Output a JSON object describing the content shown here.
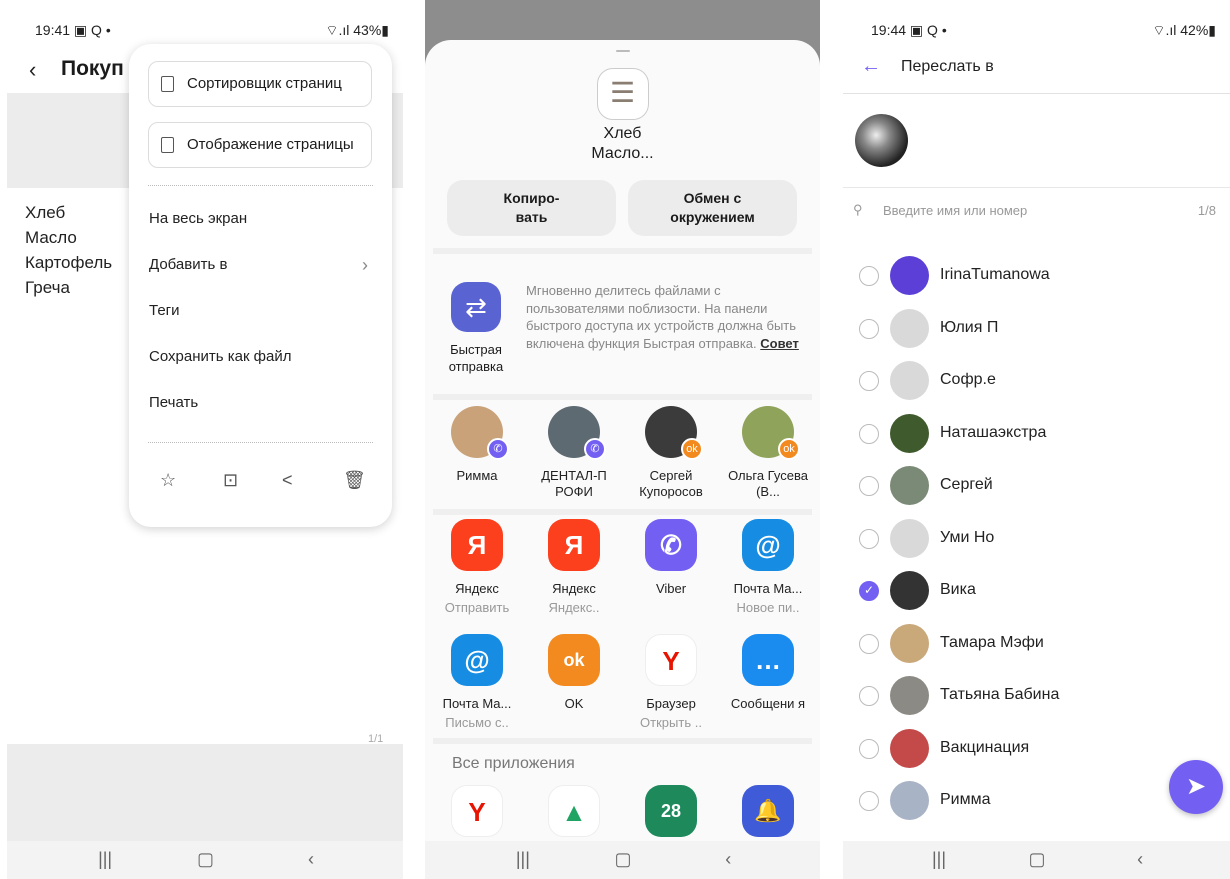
{
  "panel1": {
    "status": {
      "time": "19:41 ▣ Q •",
      "right": "⌔.ıl 43%▮"
    },
    "title": "Покуп",
    "note_lines": [
      "Хлеб",
      "Масло",
      "Картофель",
      "Греча"
    ],
    "pager": "1/1",
    "menu": {
      "btn_sorter": "Сортировщик страниц",
      "btn_display": "Отображение страницы",
      "items": [
        "На весь экран",
        "Добавить в",
        "Теги",
        "Сохранить как файл",
        "Печать"
      ]
    }
  },
  "panel2": {
    "doc_title": "Хлеб\nМасло...",
    "copy_label": "Копиро-\nвать",
    "nearby_label": "Обмен с\nокружением",
    "quick_share": {
      "label": "Быстрая отправка",
      "text": "Мгновенно делитесь файлами с пользователями поблизости. На панели быстрого доступа их устройств должна быть включена функция Быстрая отправка.",
      "link": "Совет"
    },
    "direct": [
      {
        "name": "Римма",
        "badge": "viber"
      },
      {
        "name": "ДЕНТАЛ-П РОФИ",
        "badge": "viber"
      },
      {
        "name": "Сергей Купоросов",
        "badge": "ok"
      },
      {
        "name": "Ольга Гусева (В...",
        "badge": "ok"
      }
    ],
    "apps_row1": [
      {
        "name": "Яндекс",
        "sub": "Отправить",
        "glyph": "Я",
        "color": "#fc3f1d"
      },
      {
        "name": "Яндекс",
        "sub": "Яндекс..",
        "glyph": "Я",
        "color": "#fc3f1d"
      },
      {
        "name": "Viber",
        "sub": "",
        "glyph": "✆",
        "color": "#7360f2"
      },
      {
        "name": "Почта Ма...",
        "sub": "Новое пи..",
        "glyph": "@",
        "color": "#168de2"
      }
    ],
    "apps_row2": [
      {
        "name": "Почта Ма...",
        "sub": "Письмо с..",
        "glyph": "@",
        "color": "#168de2"
      },
      {
        "name": "OK",
        "sub": "",
        "glyph": "ok",
        "color": "#f28a1f"
      },
      {
        "name": "Браузер",
        "sub": "Открыть ..",
        "glyph": "Y",
        "color": "#ffffff"
      },
      {
        "name": "Сообщени я",
        "sub": "",
        "glyph": "…",
        "color": "#1a8cf0"
      }
    ],
    "all_apps": "Все приложения",
    "apps_row3": [
      {
        "glyph": "Y",
        "color": "#ffffff"
      },
      {
        "glyph": "▲",
        "color": "#ffffff"
      },
      {
        "glyph": "28",
        "color": "#1e8a5c"
      },
      {
        "glyph": "🔔",
        "color": "#3f5bd8"
      }
    ]
  },
  "panel3": {
    "status": {
      "time": "19:44 ▣ Q •",
      "right": "⌔.ıl 42%▮"
    },
    "title": "Переслать в",
    "search_placeholder": "Введите имя или номер",
    "count": "1/8",
    "contacts": [
      {
        "name": "IrinaTumanowa",
        "checked": false,
        "color": "#5b3fd6"
      },
      {
        "name": "Юлия П",
        "checked": false,
        "color": "#d9d9d9"
      },
      {
        "name": "Софр.е",
        "checked": false,
        "color": "#d9d9d9"
      },
      {
        "name": "Наташаэкстра",
        "checked": false,
        "color": "#3f5a2c"
      },
      {
        "name": "Сергей",
        "checked": false,
        "color": "#7b8a76"
      },
      {
        "name": "Уми Но",
        "checked": false,
        "color": "#d9d9d9"
      },
      {
        "name": "Вика",
        "checked": true,
        "color": "#333333"
      },
      {
        "name": "Тамара Мэфи",
        "checked": false,
        "color": "#c9a87a"
      },
      {
        "name": "Татьяна Бабина",
        "checked": false,
        "color": "#8c8a84"
      },
      {
        "name": "Вакцинация",
        "checked": false,
        "color": "#c44a4a"
      },
      {
        "name": "Римма",
        "checked": false,
        "color": "#a8b3c6"
      }
    ]
  }
}
